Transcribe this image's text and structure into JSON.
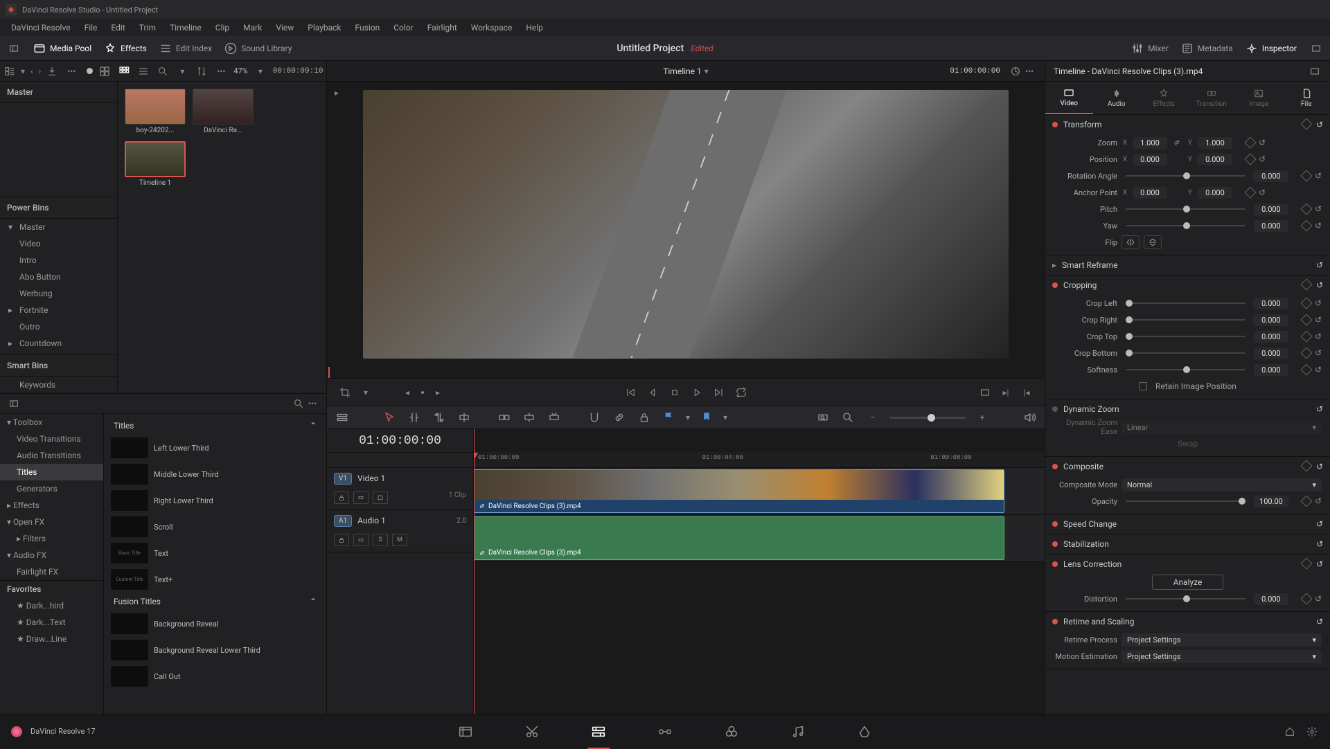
{
  "app": {
    "title": "DaVinci Resolve Studio - Untitled Project",
    "version": "DaVinci Resolve 17"
  },
  "menu": [
    "DaVinci Resolve",
    "File",
    "Edit",
    "Trim",
    "Timeline",
    "Clip",
    "Mark",
    "View",
    "Playback",
    "Fusion",
    "Color",
    "Fairlight",
    "Workspace",
    "Help"
  ],
  "toolbar": {
    "media_pool": "Media Pool",
    "effects": "Effects",
    "edit_index": "Edit Index",
    "sound_library": "Sound Library",
    "mixer": "Mixer",
    "metadata": "Metadata",
    "inspector": "Inspector",
    "project_title": "Untitled Project",
    "edited": "Edited"
  },
  "media": {
    "zoom_pct": "47%",
    "timecode": "00:00:09:10",
    "root_bin": "Master",
    "power_bins_label": "Power Bins",
    "power_bins": [
      "Master",
      "Video",
      "Intro",
      "Abo Button",
      "Werbung",
      "Fortnite",
      "Outro",
      "Countdown"
    ],
    "smart_bins_label": "Smart Bins",
    "smart_bins": [
      "Keywords"
    ],
    "clips": [
      {
        "label": "boy-24202..."
      },
      {
        "label": "DaVinci Re..."
      },
      {
        "label": "Timeline 1"
      }
    ]
  },
  "effects": {
    "nav": [
      {
        "label": "Toolbox",
        "root": true
      },
      {
        "label": "Video Transitions"
      },
      {
        "label": "Audio Transitions"
      },
      {
        "label": "Titles",
        "active": true
      },
      {
        "label": "Generators"
      },
      {
        "label": "Effects",
        "root": true
      },
      {
        "label": "Open FX",
        "root": true
      },
      {
        "label": "Filters"
      },
      {
        "label": "Audio FX",
        "root": true
      },
      {
        "label": "Fairlight FX"
      }
    ],
    "favorites_label": "Favorites",
    "favorites": [
      "Dark...hird",
      "Dark...Text",
      "Draw...Line"
    ],
    "groups": [
      {
        "header": "Titles",
        "items": [
          {
            "label": "Left Lower Third",
            "thumb": ""
          },
          {
            "label": "Middle Lower Third",
            "thumb": ""
          },
          {
            "label": "Right Lower Third",
            "thumb": ""
          },
          {
            "label": "Scroll",
            "thumb": ""
          },
          {
            "label": "Text",
            "thumb": "Basic Title"
          },
          {
            "label": "Text+",
            "thumb": "Custom Title"
          }
        ]
      },
      {
        "header": "Fusion Titles",
        "items": [
          {
            "label": "Background Reveal",
            "thumb": ""
          },
          {
            "label": "Background Reveal Lower Third",
            "thumb": ""
          },
          {
            "label": "Call Out",
            "thumb": ""
          }
        ]
      }
    ]
  },
  "viewer": {
    "title": "Timeline 1",
    "record_tc": "01:00:00:00"
  },
  "timeline": {
    "current_tc": "01:00:00:00",
    "ruler_labels": [
      "01:00:00:00",
      "01:00:04:00",
      "01:00:08:00"
    ],
    "tracks": {
      "video": {
        "badge": "V1",
        "name": "Video 1",
        "clip_count": "1 Clip"
      },
      "audio": {
        "badge": "A1",
        "name": "Audio 1",
        "meter": "2.0",
        "buttons": [
          "S",
          "M"
        ]
      }
    },
    "clip_name": "DaVinci Resolve Clips (3).mp4"
  },
  "inspector": {
    "title": "Timeline - DaVinci Resolve Clips (3).mp4",
    "tabs": [
      "Video",
      "Audio",
      "Effects",
      "Transition",
      "Image",
      "File"
    ],
    "transform": {
      "header": "Transform",
      "zoom": {
        "label": "Zoom",
        "x": "1.000",
        "y": "1.000"
      },
      "position": {
        "label": "Position",
        "x": "0.000",
        "y": "0.000"
      },
      "rotation": {
        "label": "Rotation Angle",
        "val": "0.000"
      },
      "anchor": {
        "label": "Anchor Point",
        "x": "0.000",
        "y": "0.000"
      },
      "pitch": {
        "label": "Pitch",
        "val": "0.000"
      },
      "yaw": {
        "label": "Yaw",
        "val": "0.000"
      },
      "flip": {
        "label": "Flip"
      }
    },
    "smart_reframe": "Smart Reframe",
    "cropping": {
      "header": "Cropping",
      "left": {
        "label": "Crop Left",
        "val": "0.000"
      },
      "right": {
        "label": "Crop Right",
        "val": "0.000"
      },
      "top": {
        "label": "Crop Top",
        "val": "0.000"
      },
      "bottom": {
        "label": "Crop Bottom",
        "val": "0.000"
      },
      "softness": {
        "label": "Softness",
        "val": "0.000"
      },
      "retain": "Retain Image Position"
    },
    "dynamic_zoom": {
      "header": "Dynamic Zoom",
      "ease_label": "Dynamic Zoom Ease",
      "ease_value": "Linear",
      "swap": "Swap"
    },
    "composite": {
      "header": "Composite",
      "mode_label": "Composite Mode",
      "mode_value": "Normal",
      "opacity_label": "Opacity",
      "opacity_value": "100.00"
    },
    "speed_change": "Speed Change",
    "stabilization": "Stabilization",
    "lens_correction": {
      "header": "Lens Correction",
      "analyze": "Analyze",
      "distortion_label": "Distortion",
      "distortion_value": "0.000"
    },
    "retime": {
      "header": "Retime and Scaling",
      "process_label": "Retime Process",
      "process_value": "Project Settings",
      "motion_label": "Motion Estimation",
      "motion_value": "Project Settings"
    }
  }
}
